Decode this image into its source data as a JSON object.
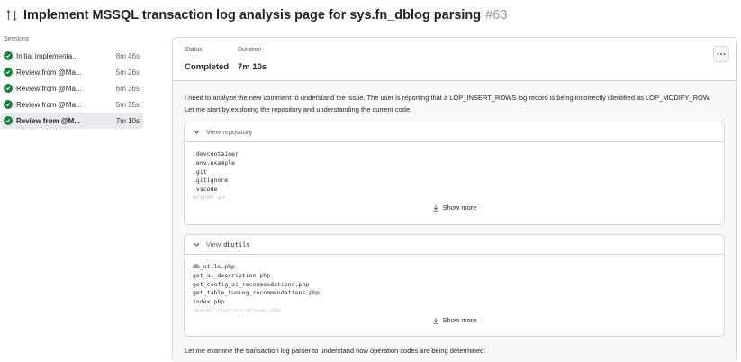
{
  "header": {
    "title": "Implement MSSQL transaction log analysis page for sys.fn_dblog parsing",
    "number": "#63"
  },
  "sidebar": {
    "label": "Sessions",
    "items": [
      {
        "label": "Initial implementa...",
        "time": "8m 46s"
      },
      {
        "label": "Review from @Ma...",
        "time": "5m 26s"
      },
      {
        "label": "Review from @Ma...",
        "time": "6m 36s"
      },
      {
        "label": "Review from @Ma...",
        "time": "5m 35s"
      },
      {
        "label": "Review from @M...",
        "time": "7m 10s"
      }
    ]
  },
  "status": {
    "status_label": "Status",
    "status_value": "Completed",
    "duration_label": "Duration",
    "duration_value": "7m 10s"
  },
  "log": {
    "intro": "I need to analyze the new comment to understand the issue. The user is reporting that a LOP_INSERT_ROWS log record is being incorrectly identified as LOP_MODIFY_ROW. Let me start by exploring the repository and understanding the current code.",
    "card1": {
      "title": "View repository",
      "lines": [
        ".devcontainer",
        ".env.example",
        ".git",
        ".gitignore",
        ".vscode",
        "README.md"
      ],
      "show_more": "Show more"
    },
    "card2": {
      "title": "View",
      "code": "dbutils",
      "lines": [
        "db_utils.php",
        "get_ai_description.php",
        "get_config_ai_recommendations.php",
        "get_table_tuning_recommendations.php",
        "index.php",
        "server_configurations.php"
      ],
      "show_more": "Show more"
    },
    "outro": "Let me examine the transaction log parser to understand how operation codes are being determined:"
  },
  "colors": {
    "success": "#1a7f37",
    "border": "#d1d9e0",
    "muted": "#59636e",
    "active_bg": "#e8eaed"
  }
}
